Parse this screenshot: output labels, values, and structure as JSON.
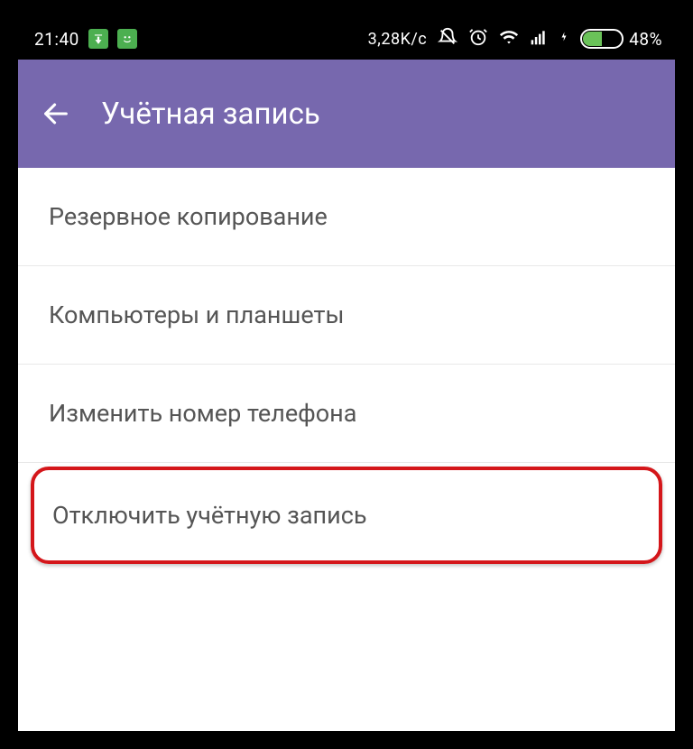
{
  "status_bar": {
    "time": "21:40",
    "net_speed": "3,28K/c",
    "battery_pct": "48%"
  },
  "app_bar": {
    "title": "Учётная запись"
  },
  "settings": {
    "items": [
      {
        "label": "Резервное копирование"
      },
      {
        "label": "Компьютеры и планшеты"
      },
      {
        "label": "Изменить номер телефона"
      },
      {
        "label": "Отключить учётную запись",
        "highlighted": true
      }
    ]
  },
  "colors": {
    "accent": "#7768ae",
    "highlight_border": "#d4161a",
    "battery_fill": "#6ac259"
  }
}
